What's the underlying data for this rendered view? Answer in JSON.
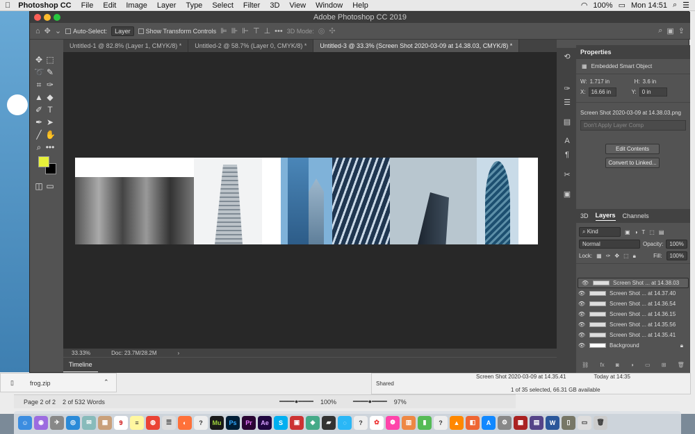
{
  "menubar": {
    "app": "Photoshop CC",
    "items": [
      "File",
      "Edit",
      "Image",
      "Layer",
      "Type",
      "Select",
      "Filter",
      "3D",
      "View",
      "Window",
      "Help"
    ],
    "battery": "100%",
    "time": "Mon 14:51"
  },
  "window": {
    "title": "Adobe Photoshop CC 2019"
  },
  "options": {
    "auto_select_label": "Auto-Select:",
    "auto_select_value": "Layer",
    "show_transform": "Show Transform Controls",
    "mode_3d": "3D Mode:"
  },
  "tabs": [
    "Untitled-1 @ 82.8% (Layer 1, CMYK/8) *",
    "Untitled-2 @ 58.7% (Layer 0, CMYK/8) *",
    "Untitled-3 @ 33.3% (Screen Shot 2020-03-09 at 14.38.03, CMYK/8) *"
  ],
  "status": {
    "zoom": "33.33%",
    "doc": "Doc: 23.7M/28.2M",
    "arrow": "›"
  },
  "timeline": "Timeline",
  "properties": {
    "title": "Properties",
    "type": "Embedded Smart Object",
    "w_label": "W:",
    "w_value": "1.717 in",
    "h_label": "H:",
    "h_value": "3.6 in",
    "x_label": "X:",
    "x_value": "16.66 in",
    "y_label": "Y:",
    "y_value": "0 in",
    "file": "Screen Shot 2020-03-09 at 14.38.03.png",
    "layer_comp": "Don't Apply Layer Comp",
    "edit_btn": "Edit Contents",
    "convert_btn": "Convert to Linked..."
  },
  "layers_panel": {
    "tabs": [
      "3D",
      "Layers",
      "Channels"
    ],
    "kind": "Kind",
    "blend": "Normal",
    "opacity_label": "Opacity:",
    "opacity": "100%",
    "lock_label": "Lock:",
    "fill_label": "Fill:",
    "fill": "100%",
    "layers": [
      "Screen Shot ... at 14.38.03",
      "Screen Shot ... at 14.37.40",
      "Screen Shot ... at 14.36.54",
      "Screen Shot ... at 14.36.15",
      "Screen Shot ... at 14.35.56",
      "Screen Shot ... at 14.35.41",
      "Background"
    ]
  },
  "background_apps": {
    "download_file": "frog.zip",
    "pages_status": "Page 2 of 2",
    "word_count": "2 of 532 Words",
    "zoom_left": "100%",
    "zoom_right": "97%",
    "finder_row1": "Screen Shot 2020-03-09 at 14.35.41",
    "finder_row1_date": "Today at 14:35",
    "finder_shared": "Shared",
    "finder_status": "1 of 35 selected, 66.31 GB available"
  },
  "dock": [
    "Mu",
    "Ps",
    "Pr",
    "Ae",
    "W"
  ],
  "colors": {
    "foreground": "#e6f03a",
    "background": "#000000"
  }
}
